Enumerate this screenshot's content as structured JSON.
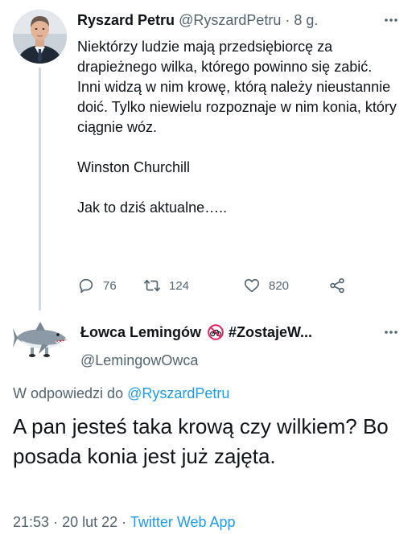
{
  "top_tweet": {
    "author_name": "Ryszard Petru",
    "author_handle": "@RyszardPetru",
    "separator": "·",
    "time_ago": "8 g.",
    "paragraphs": [
      "Niektórzy ludzie mają przedsiębiorcę za drapieżnego wilka, którego powinno się zabić. Inni widzą w nim krowę, którą należy nieustannie doić. Tylko niewielu rozpoznaje w nim konia, który ciągnie wóz.",
      "Winston Churchill",
      "Jak to dziś aktualne….."
    ],
    "actions": {
      "reply_count": "76",
      "retweet_count": "124",
      "like_count": "820"
    },
    "icons": {
      "more": "more-icon",
      "reply": "reply-icon",
      "retweet": "retweet-icon",
      "like": "heart-icon",
      "share": "share-icon"
    }
  },
  "reply_tweet": {
    "author_name": "Łowca Lemingów",
    "author_name_suffix": "#ZostajeW...",
    "author_handle": "@LemingowOwca",
    "replying_prefix": "W odpowiedzi do",
    "replying_mention": "@RyszardPetru",
    "text": "A pan jesteś taka  krową czy wilkiem? Bo posada konia jest już zajęta.",
    "time": "21:53",
    "separator": "·",
    "date": "20 lut 22",
    "separator2": "·",
    "source": "Twitter Web App",
    "icons": {
      "avatar": "shark-icon",
      "badge": "no-bicycle-icon",
      "more": "more-icon"
    }
  },
  "colors": {
    "text_primary": "#0f1419",
    "text_secondary": "#536471",
    "link": "#1d9bf0",
    "thread_line": "#cfd9de",
    "no_bike_red": "#e0245e"
  }
}
